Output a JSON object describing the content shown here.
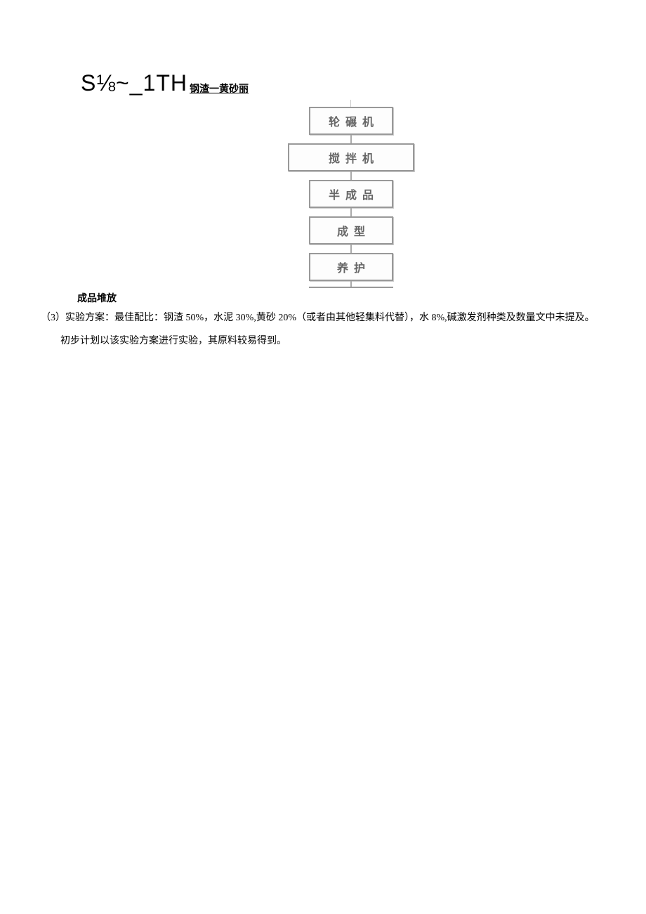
{
  "header": {
    "formula": "S⅛~_1TH",
    "subscript": "钢渣一黄砂丽"
  },
  "flowchart": {
    "boxes": [
      {
        "label": "轮碾机",
        "width": "narrow"
      },
      {
        "label": "搅拌机",
        "width": "wide"
      },
      {
        "label": "半成品",
        "width": "narrow"
      },
      {
        "label": "成型",
        "width": "narrow"
      },
      {
        "label": "养护",
        "width": "narrow"
      }
    ]
  },
  "product_label": "成品堆放",
  "paragraphs": [
    "（3）实验方案：最佳配比：钢渣 50%，水泥 30%,黄砂 20%（或者由其他轻集料代替），水 8%,碱激发剂种类及数量文中未提及。",
    "初步计划以该实验方案进行实验，其原料较易得到。"
  ]
}
